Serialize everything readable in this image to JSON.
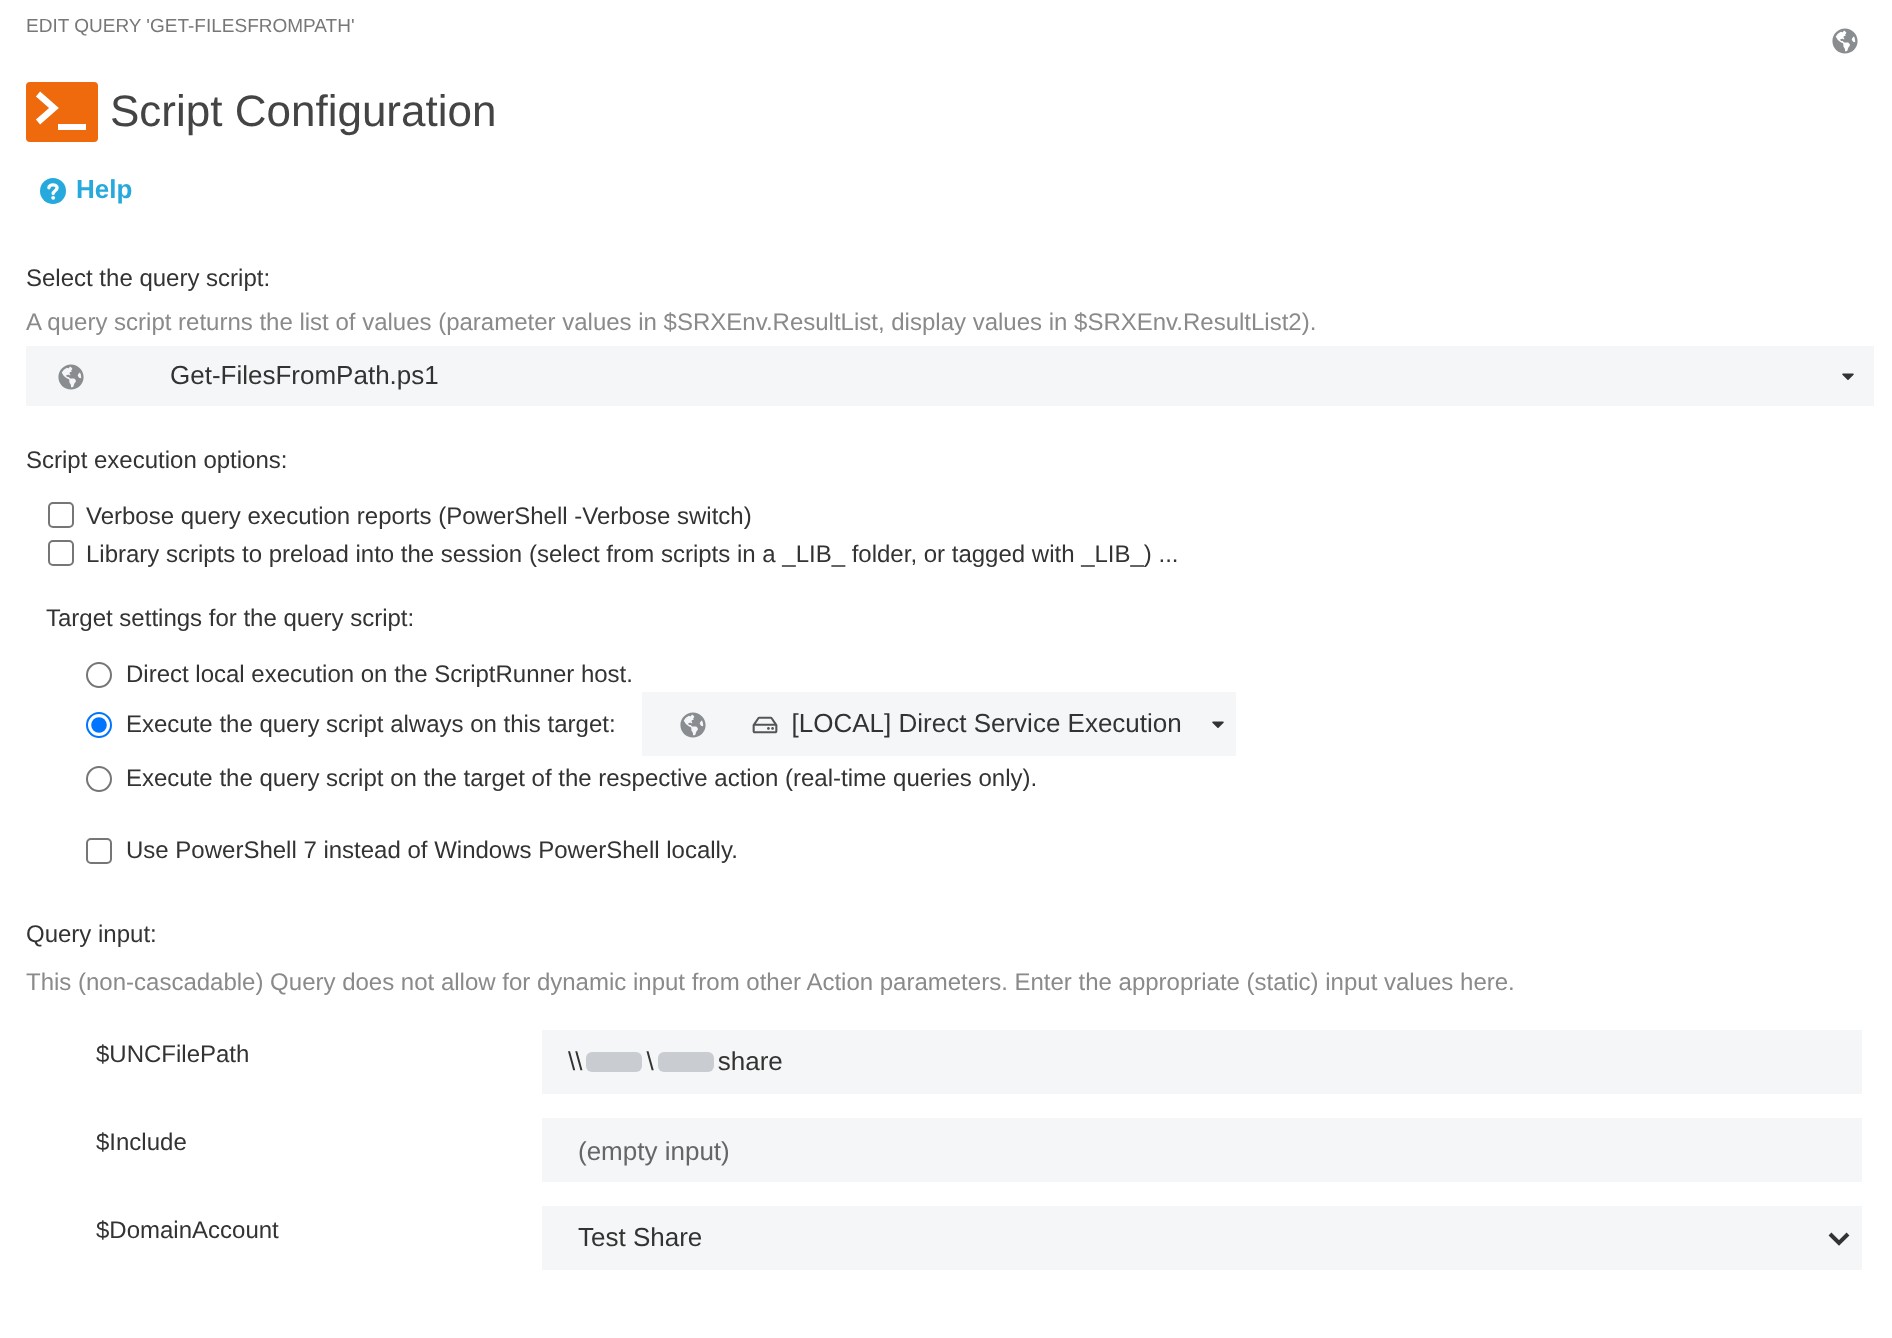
{
  "breadcrumb": "EDIT QUERY 'GET-FILESFROMPATH'",
  "title": "Script Configuration",
  "help_link": "Help",
  "query_script": {
    "label": "Select the query script:",
    "description": "A query script returns the list of values (parameter values in $SRXEnv.ResultList, display values in $SRXEnv.ResultList2).",
    "value": "Get-FilesFromPath.ps1"
  },
  "execution_options": {
    "label": "Script execution options:",
    "options": [
      {
        "label": "Verbose query execution reports (PowerShell -Verbose switch)",
        "checked": false
      },
      {
        "label": "Library scripts to preload into the session (select from scripts in a _LIB_ folder, or tagged with _LIB_) ...",
        "checked": false
      }
    ]
  },
  "target_settings": {
    "label": "Target settings for the query script:",
    "options": [
      {
        "label": "Direct local execution on the ScriptRunner host.",
        "selected": false
      },
      {
        "label": "Execute the query script always on this target:",
        "selected": true,
        "target": "[LOCAL] Direct Service Execution"
      },
      {
        "label": "Execute the query script on the target of the respective action (real-time queries only).",
        "selected": false
      }
    ],
    "powershell7": {
      "label": "Use PowerShell 7 instead of Windows PowerShell locally.",
      "checked": false
    }
  },
  "query_input": {
    "label": "Query input:",
    "description": "This (non-cascadable) Query does not allow for dynamic input from other Action parameters. Enter the appropriate (static) input values here.",
    "parameters": [
      {
        "name": "$UNCFilePath",
        "kind": "text",
        "value_segments": [
          {
            "kind": "text",
            "text": "\\\\"
          },
          {
            "kind": "blurred"
          },
          {
            "kind": "text",
            "text": "\\"
          },
          {
            "kind": "blurred"
          },
          {
            "kind": "text",
            "text": "share"
          }
        ]
      },
      {
        "name": "$Include",
        "kind": "text",
        "placeholder": "(empty input)"
      },
      {
        "name": "$DomainAccount",
        "kind": "select",
        "value": "Test Share"
      }
    ]
  }
}
